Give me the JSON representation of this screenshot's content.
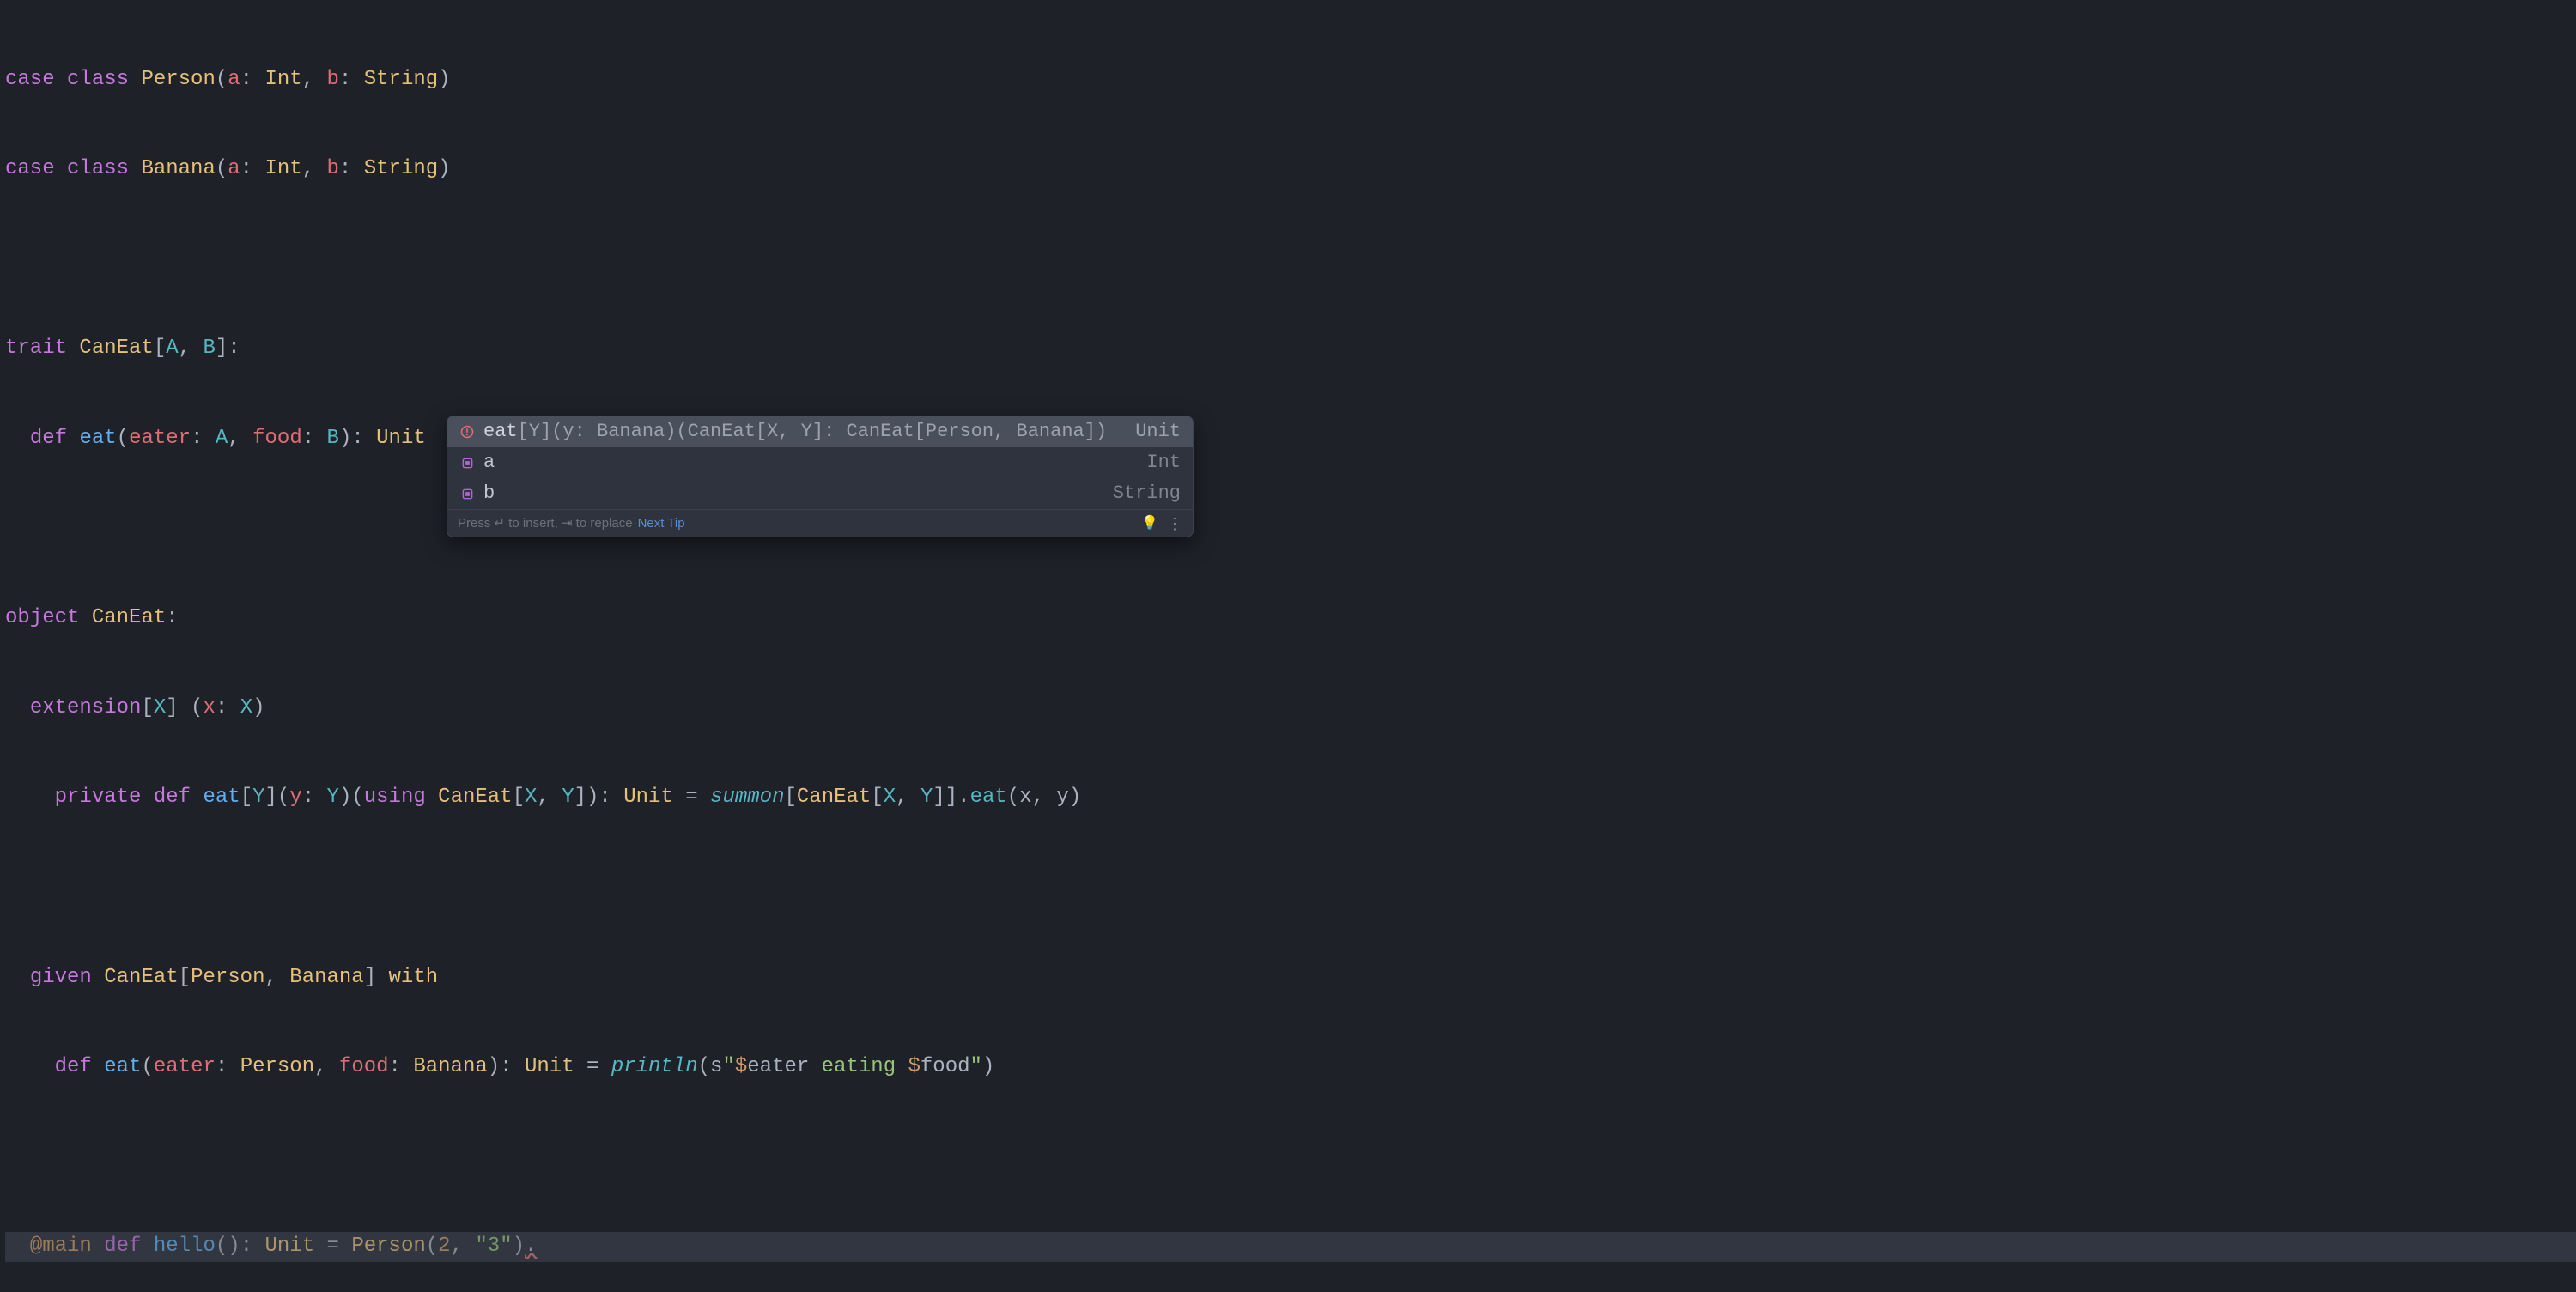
{
  "code": {
    "l1": {
      "kw1": "case",
      "kw2": "class",
      "name": "Person",
      "p1": "a",
      "t1": "Int",
      "p2": "b",
      "t2": "String"
    },
    "l2": {
      "kw1": "case",
      "kw2": "class",
      "name": "Banana",
      "p1": "a",
      "t1": "Int",
      "p2": "b",
      "t2": "String"
    },
    "l4": {
      "kw": "trait",
      "name": "CanEat",
      "tp1": "A",
      "tp2": "B"
    },
    "l5": {
      "kw": "def",
      "name": "eat",
      "p1": "eater",
      "t1": "A",
      "p2": "food",
      "t2": "B",
      "ret": "Unit"
    },
    "l7": {
      "kw": "object",
      "name": "CanEat"
    },
    "l8": {
      "kw": "extension",
      "tp": "X",
      "pn": "x",
      "pt": "X"
    },
    "l9": {
      "kw1": "private",
      "kw2": "def",
      "name": "eat",
      "tp": "Y",
      "p": "y",
      "pt": "Y",
      "using": "using",
      "ce": "CanEat",
      "x": "X",
      "y": "Y",
      "ret": "Unit",
      "summon": "summon",
      "x2": "X",
      "y2": "Y",
      "eat2": "eat",
      "a1": "x",
      "a2": "y"
    },
    "l11": {
      "kw": "given",
      "ce": "CanEat",
      "t1": "Person",
      "t2": "Banana",
      "with": "with"
    },
    "l12": {
      "kw": "def",
      "name": "eat",
      "p1": "eater",
      "t1": "Person",
      "p2": "food",
      "t2": "Banana",
      "ret": "Unit",
      "println": "println",
      "s": "s",
      "q1": "\"",
      "d1": "$",
      "v1": "eater",
      "mid": " eating ",
      "d2": "$",
      "v2": "food",
      "q2": "\""
    },
    "l14": {
      "at": "@main",
      "kw": "def",
      "name": "hello",
      "ret": "Unit",
      "cls": "Person",
      "n": "2",
      "str": "\"3\""
    }
  },
  "completion": {
    "items": [
      {
        "icon": "error",
        "name": "eat",
        "sig": "[Y](y: Banana)(CanEat[X, Y]: CanEat[Person, Banana])",
        "type": "Unit",
        "selected": true
      },
      {
        "icon": "field",
        "name": "a",
        "sig": "",
        "type": "Int",
        "selected": false
      },
      {
        "icon": "field",
        "name": "b",
        "sig": "",
        "type": "String",
        "selected": false
      }
    ],
    "footer": {
      "hint": "Press ↵ to insert, ⇥ to replace",
      "link": "Next Tip"
    }
  }
}
